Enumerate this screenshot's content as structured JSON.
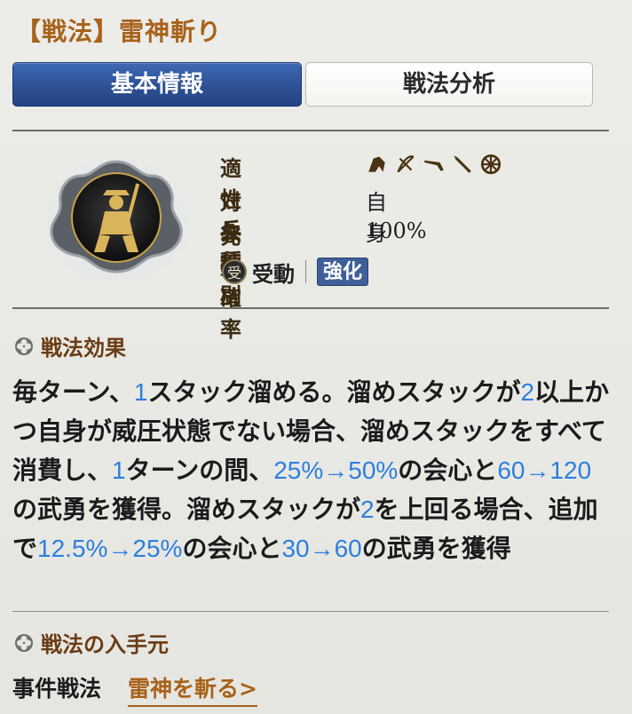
{
  "header": {
    "title": "【戦法】雷神斬り"
  },
  "tabs": [
    {
      "label": "基本情報",
      "active": true
    },
    {
      "label": "戦法分析",
      "active": false
    }
  ],
  "info": {
    "troop_label": "適性兵種",
    "troop_icons": [
      "cavalry-icon",
      "bow-icon",
      "gun-icon",
      "spear-icon",
      "shield-icon"
    ],
    "target_label": "対象種別",
    "target_value": "自身",
    "rate_label": "発動確率",
    "rate_value": "100%",
    "type_icon_text": "受",
    "type_text": "受動",
    "badge": "強化"
  },
  "effect": {
    "title": "戦法効果",
    "parts": [
      "毎ターン、",
      "1",
      "スタック溜める。溜めスタックが",
      "2",
      "以上かつ自身が威圧状態でない場合、溜めスタックをすべて消費し、",
      "1",
      "ターンの間、",
      "25%→50%",
      "の会心と",
      "60→120",
      "の武勇を獲得。溜めスタックが",
      "2",
      "を上回る場合、追加で",
      "12.5%→25%",
      "の会心と",
      "30→60",
      "の武勇を獲得"
    ]
  },
  "source": {
    "title": "戦法の入手元",
    "label": "事件戦法",
    "link": "雷神を斬る>"
  },
  "colors": {
    "accent_gold": "#a8621a",
    "tab_blue": "#2c4f92",
    "highlight_blue": "#2d7fe0"
  }
}
